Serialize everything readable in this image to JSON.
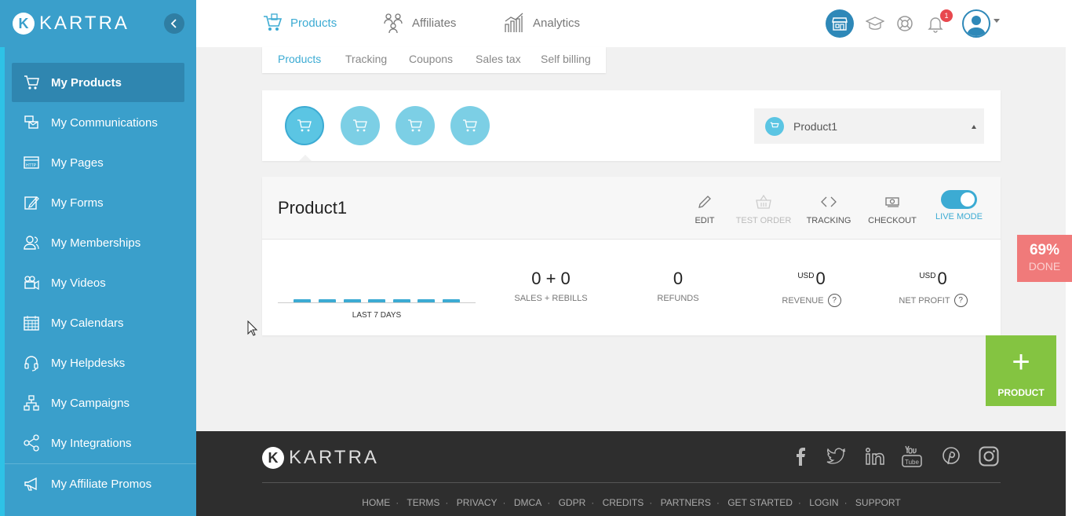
{
  "brand": {
    "logo_letter": "K",
    "name": "KARTRA"
  },
  "sidebar": {
    "items": [
      {
        "label": "My Products",
        "icon": "cart-icon",
        "active": true
      },
      {
        "label": "My Communications",
        "icon": "communications-icon"
      },
      {
        "label": "My Pages",
        "icon": "http-icon"
      },
      {
        "label": "My Forms",
        "icon": "form-edit-icon"
      },
      {
        "label": "My Memberships",
        "icon": "users-icon"
      },
      {
        "label": "My Videos",
        "icon": "video-camera-icon"
      },
      {
        "label": "My Calendars",
        "icon": "calendar-icon"
      },
      {
        "label": "My Helpdesks",
        "icon": "headset-icon"
      },
      {
        "label": "My Campaigns",
        "icon": "sitemap-icon"
      },
      {
        "label": "My Integrations",
        "icon": "share-icon"
      },
      {
        "label": "My Affiliate Promos",
        "icon": "megaphone-icon"
      }
    ]
  },
  "header": {
    "tabs": [
      {
        "label": "Products",
        "icon": "cart-icon",
        "active": true
      },
      {
        "label": "Affiliates",
        "icon": "affiliates-icon"
      },
      {
        "label": "Analytics",
        "icon": "chart-icon"
      }
    ],
    "notification_count": "1"
  },
  "subtabs": [
    {
      "label": "Products",
      "active": true
    },
    {
      "label": "Tracking"
    },
    {
      "label": "Coupons"
    },
    {
      "label": "Sales tax"
    },
    {
      "label": "Self billing"
    }
  ],
  "selector": {
    "selected_product": "Product1"
  },
  "product": {
    "title": "Product1",
    "actions": [
      {
        "label": "EDIT",
        "icon": "pencil-icon",
        "enabled": true
      },
      {
        "label": "TEST ORDER",
        "icon": "basket-icon",
        "enabled": false
      },
      {
        "label": "TRACKING",
        "icon": "code-icon",
        "enabled": true
      },
      {
        "label": "CHECKOUT",
        "icon": "money-icon",
        "enabled": true
      }
    ],
    "live_mode_label": "LIVE MODE",
    "live_mode_on": true,
    "spark_label": "LAST 7 DAYS",
    "stats": {
      "sales": "0 + 0",
      "sales_label": "SALES + REBILLS",
      "refunds": "0",
      "refunds_label": "REFUNDS",
      "revenue_currency": "USD",
      "revenue": "0",
      "revenue_label": "REVENUE",
      "profit_currency": "USD",
      "profit": "0",
      "profit_label": "NET PROFIT",
      "help": "?"
    }
  },
  "progress": {
    "percent": "69%",
    "label": "DONE"
  },
  "add_product": {
    "plus": "+",
    "label": "PRODUCT"
  },
  "footer": {
    "social": [
      "facebook-icon",
      "twitter-icon",
      "linkedin-icon",
      "youtube-icon",
      "pinterest-icon",
      "instagram-icon"
    ],
    "links": [
      "HOME",
      "TERMS",
      "PRIVACY",
      "DMCA",
      "GDPR",
      "CREDITS",
      "PARTNERS",
      "GET STARTED",
      "LOGIN",
      "SUPPORT"
    ]
  },
  "colors": {
    "sidebar": "#3a9fcb",
    "accent": "#3cabd3",
    "progress": "#f07a7a",
    "add_button": "#84c441",
    "footer": "#2e2e2e"
  }
}
